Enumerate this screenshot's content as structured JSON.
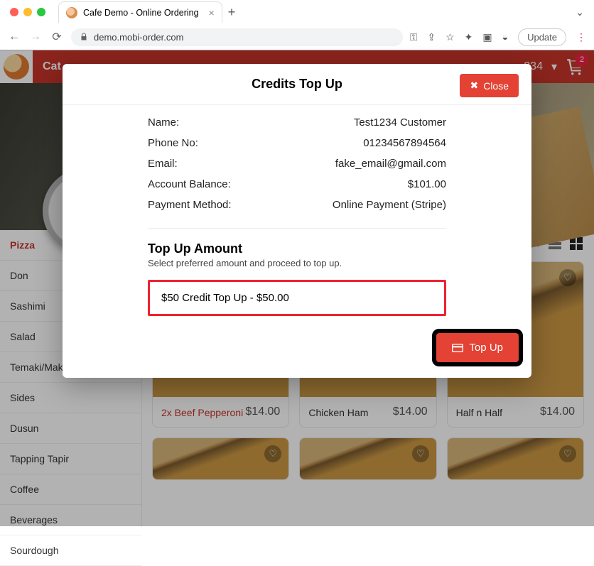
{
  "browser": {
    "tab_title": "Cafe Demo - Online Ordering",
    "url": "demo.mobi-order.com",
    "update_label": "Update"
  },
  "header": {
    "category_label": "Cat",
    "user_label": "234",
    "cart_count": "2"
  },
  "sidebar": {
    "items": [
      {
        "label": "Pizza",
        "active": true
      },
      {
        "label": "Don"
      },
      {
        "label": "Sashimi"
      },
      {
        "label": "Salad"
      },
      {
        "label": "Temaki/Maki"
      },
      {
        "label": "Sides"
      },
      {
        "label": "Dusun"
      },
      {
        "label": "Tapping Tapir"
      },
      {
        "label": "Coffee"
      },
      {
        "label": "Beverages"
      },
      {
        "label": "Sourdough"
      }
    ]
  },
  "products": [
    {
      "name": "2x Beef Pepperoni",
      "price": "$14.00",
      "hot": true
    },
    {
      "name": "Chicken Ham",
      "price": "$14.00"
    },
    {
      "name": "Half n Half",
      "price": "$14.00"
    }
  ],
  "modal": {
    "title": "Credits Top Up",
    "close_label": "Close",
    "rows": {
      "name_label": "Name:",
      "name_value": "Test1234 Customer",
      "phone_label": "Phone No:",
      "phone_value": "01234567894564",
      "email_label": "Email:",
      "email_value": "fake_email@gmail.com",
      "balance_label": "Account Balance:",
      "balance_value": "$101.00",
      "method_label": "Payment Method:",
      "method_value": "Online Payment (Stripe)"
    },
    "section_title": "Top Up Amount",
    "section_sub": "Select preferred amount and proceed to top up.",
    "selected_amount": "$50 Credit Top Up - $50.00",
    "topup_label": "Top Up"
  }
}
